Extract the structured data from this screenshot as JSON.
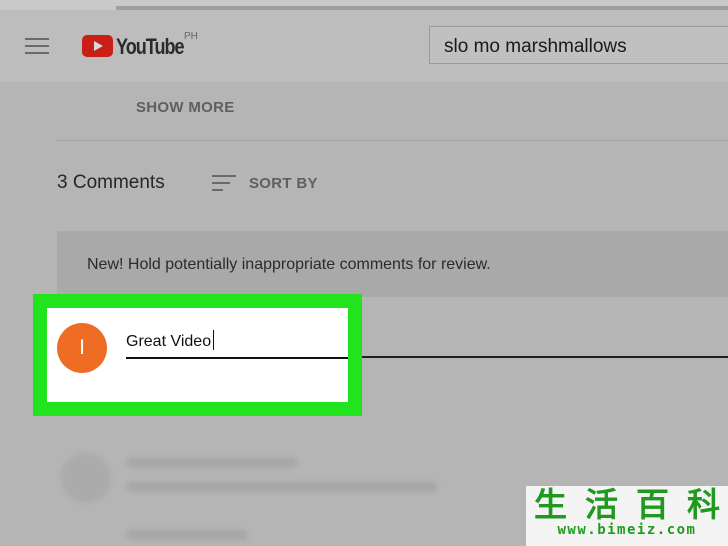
{
  "header": {
    "logo_text": "YouTube",
    "country_code": "PH",
    "search_value": "slo mo marshmallows"
  },
  "description": {
    "show_more_label": "SHOW MORE"
  },
  "comments": {
    "count_label": "3 Comments",
    "sort_label": "SORT BY",
    "notice_text": "New! Hold potentially inappropriate comments for review.",
    "user_initial": "I",
    "input_value": "Great Video"
  },
  "watermark": {
    "chars": [
      "生",
      "活",
      "百",
      "科"
    ],
    "url": "www.bimeiz.com"
  },
  "colors": {
    "highlight": "#22e41e",
    "avatar": "#ef6c24",
    "logo_red": "#e62117",
    "watermark_green": "#1f9a1f"
  },
  "icons": {
    "menu": "hamburger-menu-icon",
    "logo": "youtube-play-icon",
    "sort": "sort-icon"
  }
}
